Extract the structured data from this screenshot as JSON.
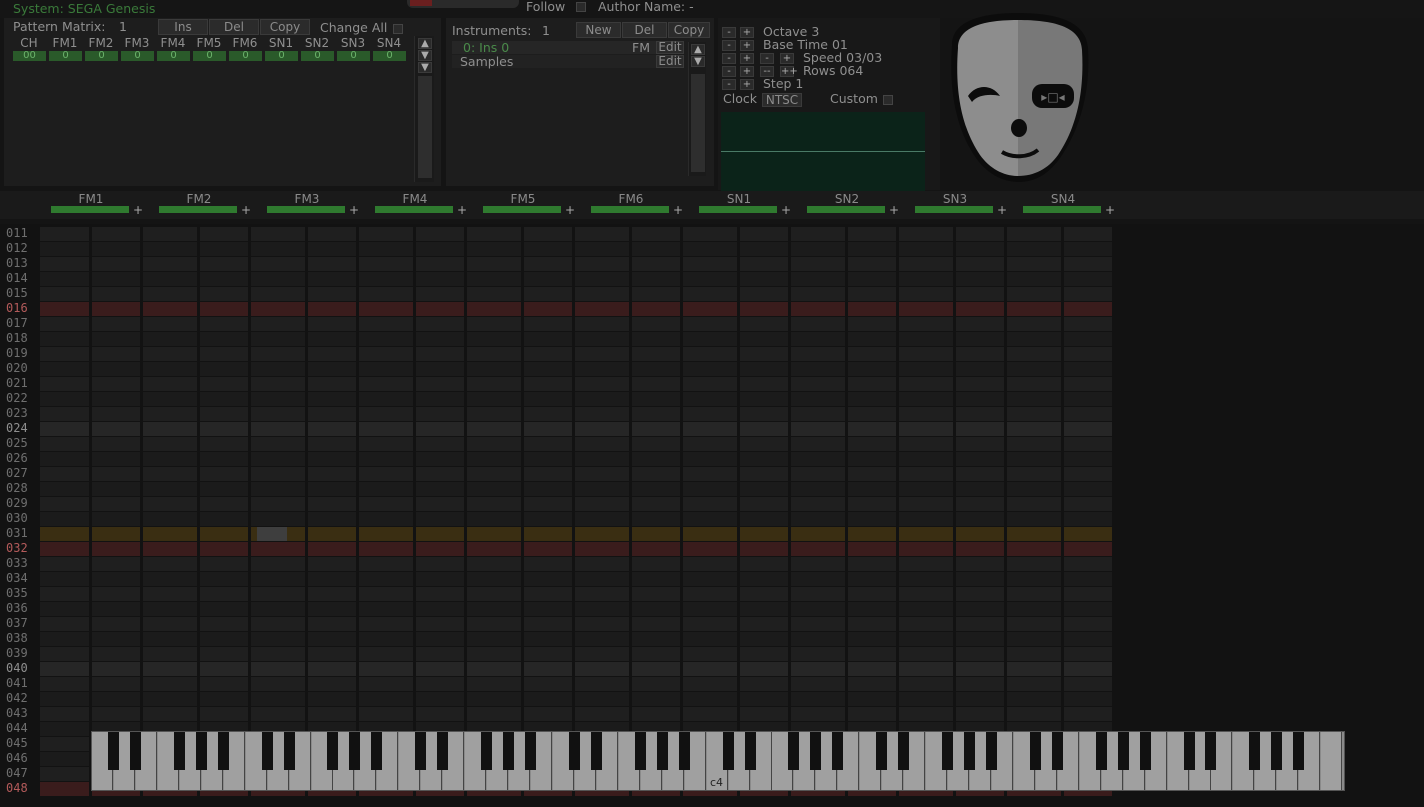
{
  "topbar": {
    "system_label": "System: SEGA Genesis",
    "follow_label": "Follow",
    "author_label": "Author Name: -"
  },
  "matrix": {
    "title": "Pattern Matrix:",
    "count": "1",
    "ins": "Ins",
    "del": "Del",
    "copy": "Copy",
    "change_all": "Change All",
    "columns": [
      "CH",
      "FM1",
      "FM2",
      "FM3",
      "FM4",
      "FM5",
      "FM6",
      "SN1",
      "SN2",
      "SN3",
      "SN4"
    ],
    "values": [
      "00",
      "0",
      "0",
      "0",
      "0",
      "0",
      "0",
      "0",
      "0",
      "0",
      "0"
    ]
  },
  "instruments": {
    "title": "Instruments:",
    "count": "1",
    "new": "New",
    "del": "Del",
    "copy": "Copy",
    "item_name": "0: Ins 0",
    "item_type": "FM",
    "edit": "Edit",
    "samples": "Samples",
    "samples_edit": "Edit"
  },
  "sequencer": {
    "octave": "Octave 3",
    "base_time": "Base Time 01",
    "speed": "Speed 03/03",
    "rows": "Rows 064",
    "step": "Step 1",
    "clock": "Clock",
    "ntsc": "NTSC",
    "custom": "Custom",
    "minus": "-",
    "plus": "+",
    "minusminus": "--",
    "plusplus": "++"
  },
  "channels": [
    "FM1",
    "FM2",
    "FM3",
    "FM4",
    "FM5",
    "FM6",
    "SN1",
    "SN2",
    "SN3",
    "SN4"
  ],
  "channel_plus": "+",
  "rows": [
    "011",
    "012",
    "013",
    "014",
    "015",
    "016",
    "017",
    "018",
    "019",
    "020",
    "021",
    "022",
    "023",
    "024",
    "025",
    "026",
    "027",
    "028",
    "029",
    "030",
    "031",
    "032",
    "033",
    "034",
    "035",
    "036",
    "037",
    "038",
    "039",
    "040",
    "041",
    "042",
    "043",
    "044",
    "045",
    "046",
    "047",
    "048"
  ],
  "piano": {
    "label": "c4"
  },
  "colors": {
    "accent_green": "#2f7a2f",
    "scope_bg": "#0b2319",
    "cursor_red": "#3a1a1a",
    "cursor_yellow": "#3a2e10"
  }
}
